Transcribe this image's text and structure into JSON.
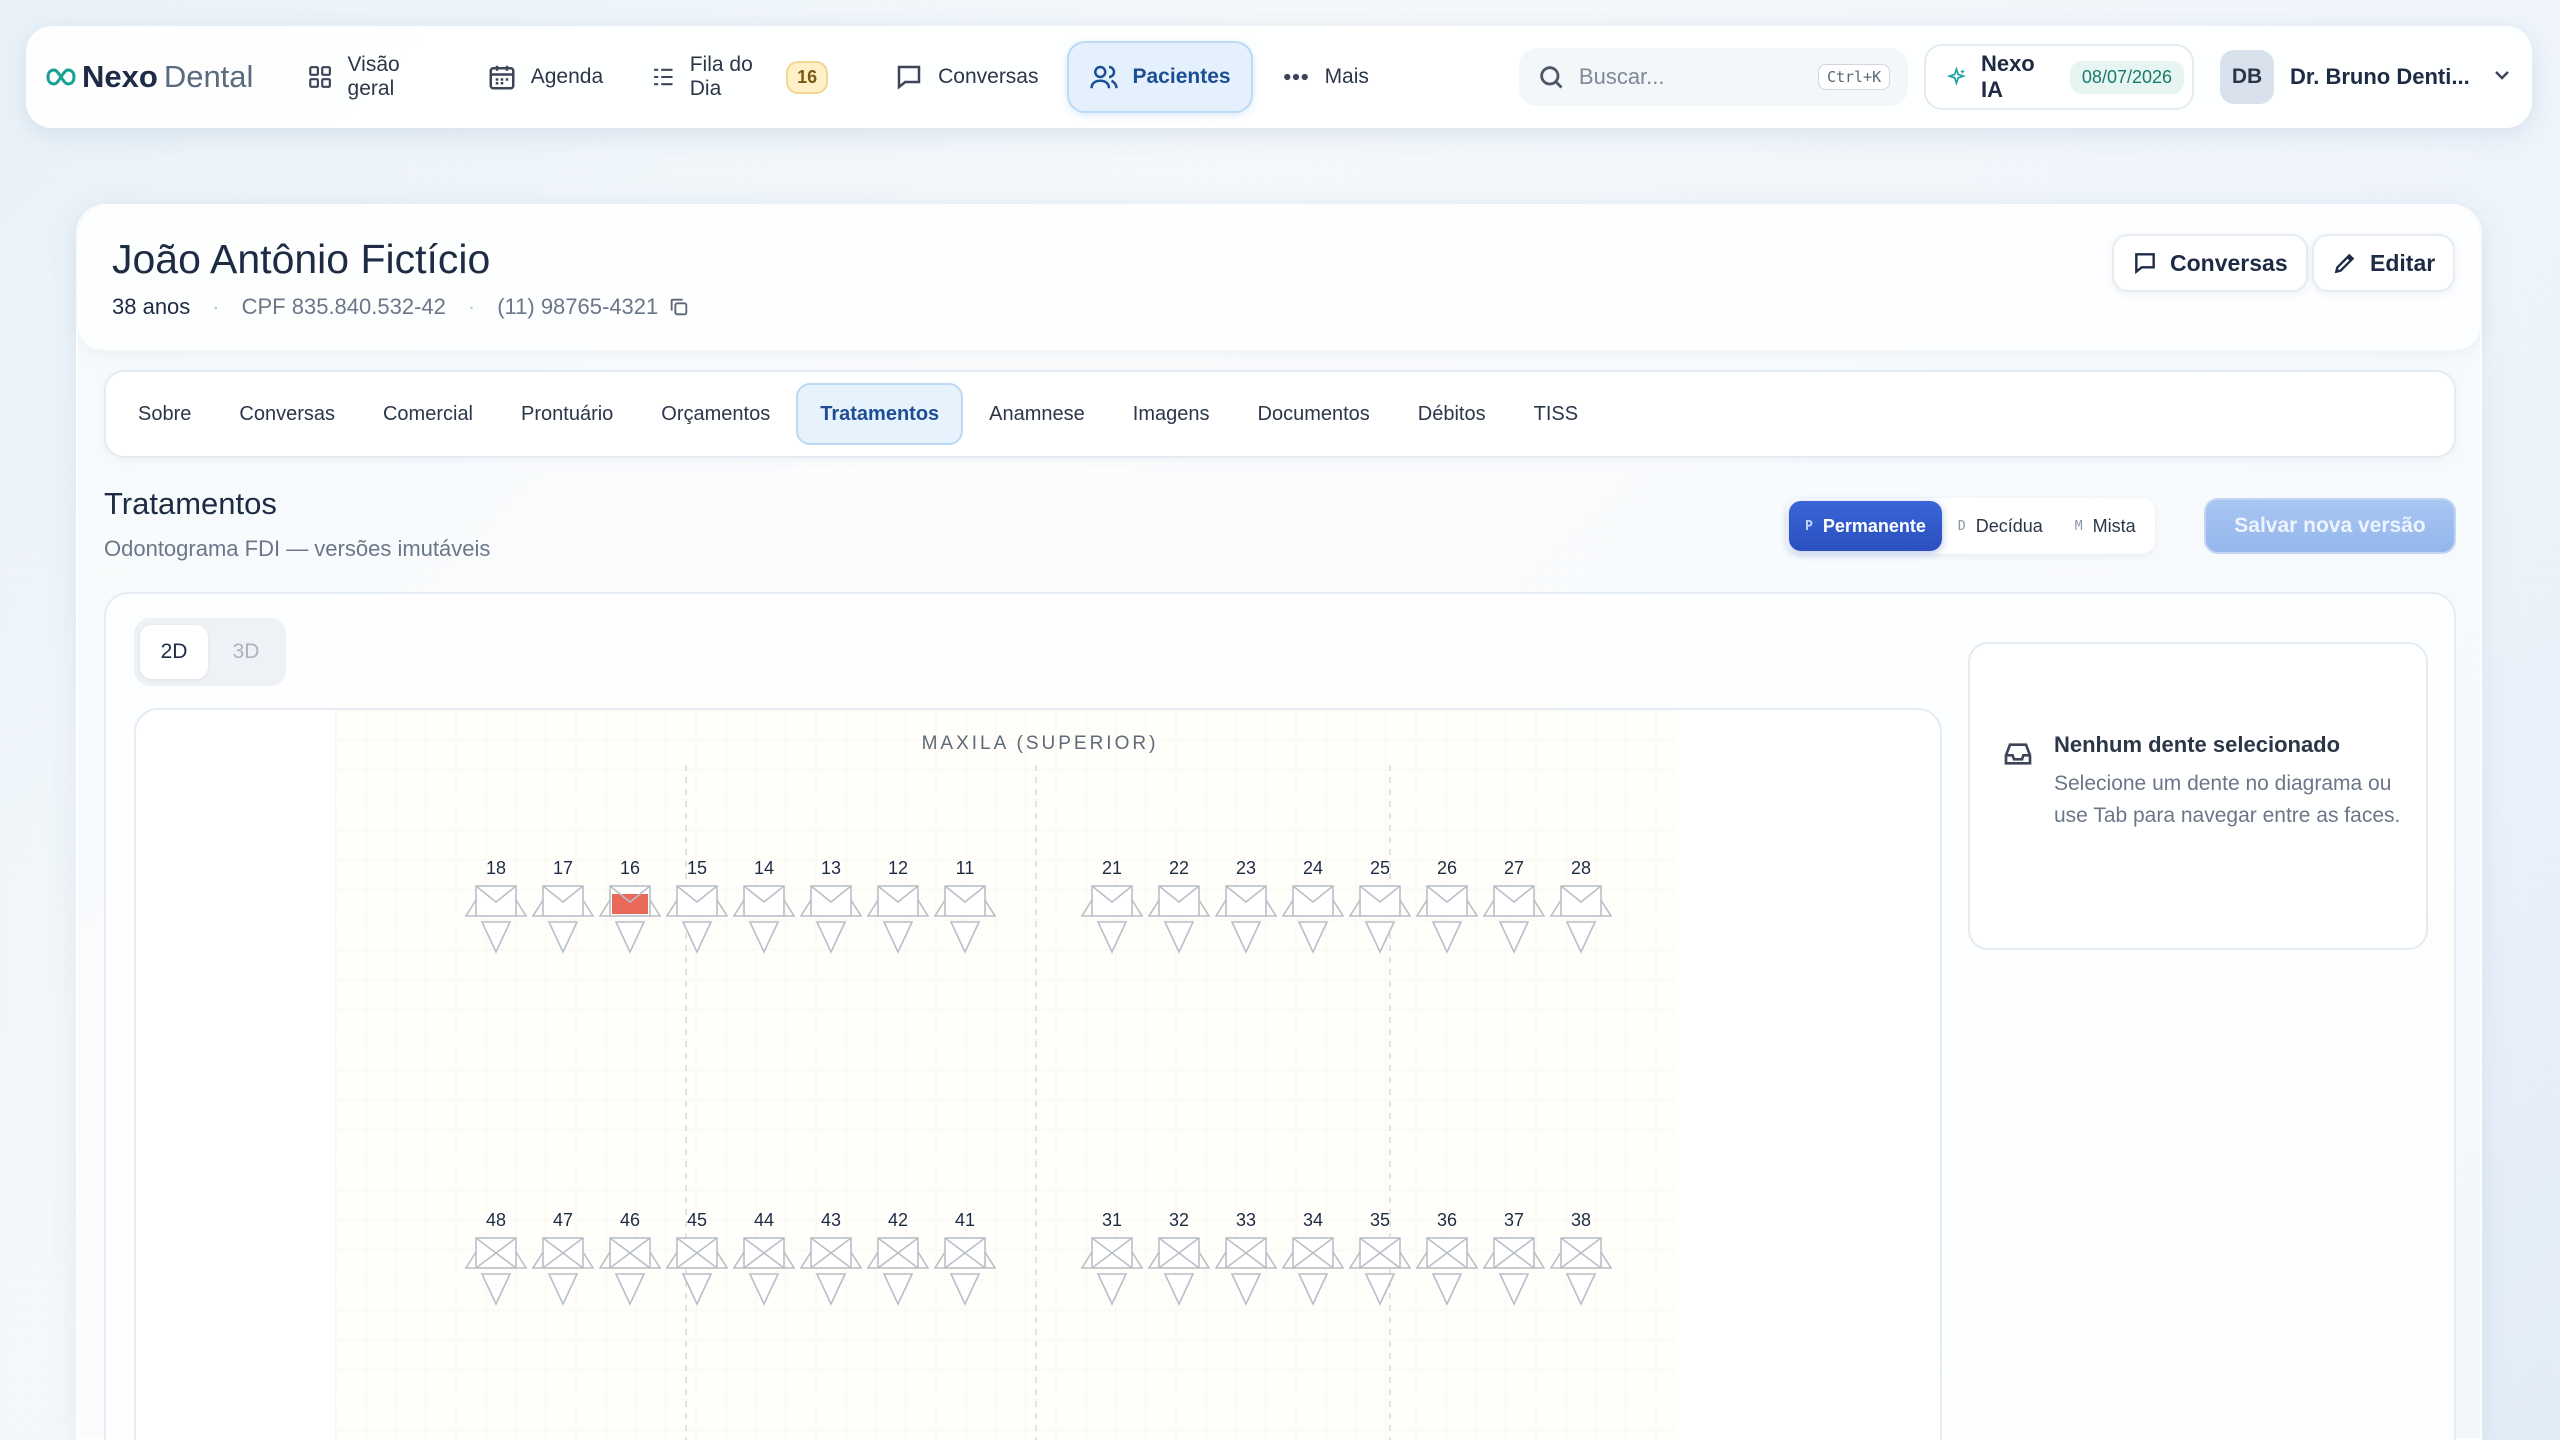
{
  "brand": {
    "part1": "Nexo",
    "part2": "Dental"
  },
  "nav": [
    {
      "label": "Visão geral",
      "icon": "grid-icon"
    },
    {
      "label": "Agenda",
      "icon": "calendar-icon"
    },
    {
      "label": "Fila do Dia",
      "icon": "list-icon",
      "badge": "16"
    },
    {
      "label": "Conversas",
      "icon": "chat-icon"
    },
    {
      "label": "Pacientes",
      "icon": "users-icon",
      "active": true
    },
    {
      "label": "Mais",
      "icon": "more-icon"
    }
  ],
  "search": {
    "placeholder": "Buscar...",
    "shortcut": "Ctrl+K"
  },
  "ia": {
    "label": "Nexo IA",
    "date": "08/07/2026"
  },
  "user": {
    "initials": "DB",
    "name": "Dr. Bruno Denti..."
  },
  "patient": {
    "name": "João Antônio Fictício",
    "age": "38 anos",
    "cpf": "CPF 835.840.532-42",
    "phone": "(11) 98765-4321"
  },
  "header_buttons": {
    "conversas": "Conversas",
    "editar": "Editar"
  },
  "tabs": [
    "Sobre",
    "Conversas",
    "Comercial",
    "Prontuário",
    "Orçamentos",
    "Tratamentos",
    "Anamnese",
    "Imagens",
    "Documentos",
    "Débitos",
    "TISS"
  ],
  "active_tab": "Tratamentos",
  "section": {
    "title": "Tratamentos",
    "subtitle": "Odontograma FDI — versões imutáveis"
  },
  "dentition": [
    {
      "key": "P",
      "label": "Permanente",
      "active": true
    },
    {
      "key": "D",
      "label": "Decídua"
    },
    {
      "key": "M",
      "label": "Mista"
    }
  ],
  "save_label": "Salvar nova versão",
  "view_toggle": [
    {
      "label": "2D",
      "active": true
    },
    {
      "label": "3D"
    }
  ],
  "odontogram": {
    "upper_label": "MAXILA (SUPERIOR)",
    "upper_right": [
      "18",
      "17",
      "16",
      "15",
      "14",
      "13",
      "12",
      "11"
    ],
    "upper_left": [
      "21",
      "22",
      "23",
      "24",
      "25",
      "26",
      "27",
      "28"
    ],
    "lower_right": [
      "48",
      "47",
      "46",
      "45",
      "44",
      "43",
      "42",
      "41"
    ],
    "lower_left": [
      "31",
      "32",
      "33",
      "34",
      "35",
      "36",
      "37",
      "38"
    ],
    "marked_teeth": [
      "16"
    ],
    "mark_color": "#e8685a"
  },
  "selection": {
    "title": "Nenhum dente selecionado",
    "description": "Selecione um dente no diagrama ou use Tab para navegar entre as faces."
  },
  "colors": {
    "accent": "#2b4fbf",
    "active_bg": "#e4f1fc",
    "badge": "#fff0c8"
  }
}
